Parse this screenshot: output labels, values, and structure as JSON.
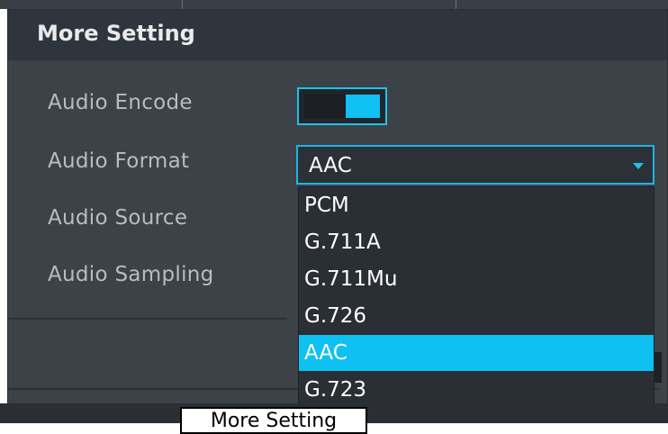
{
  "dialog": {
    "title": "More Setting",
    "fields": {
      "audio_encode": "Audio Encode",
      "audio_format": "Audio Format",
      "audio_source": "Audio Source",
      "audio_sampling": "Audio Sampling"
    },
    "audio_encode_enabled": true,
    "audio_format_value": "AAC",
    "format_options": [
      "PCM",
      "G.711A",
      "G.711Mu",
      "G.726",
      "AAC",
      "G.723"
    ],
    "format_selected_index": 4
  },
  "background": {
    "button_label": "More Setting"
  },
  "colors": {
    "accent": "#0fc0f3",
    "dialog_bg": "#3d4248",
    "header_bg": "#2f353c"
  }
}
